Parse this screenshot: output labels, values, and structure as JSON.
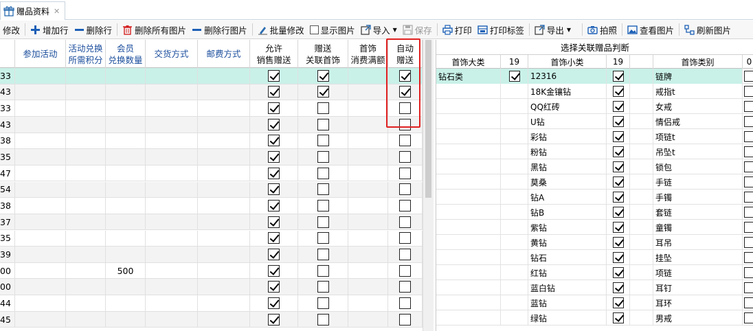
{
  "tab": {
    "label": "赠品资料",
    "close": "✕"
  },
  "toolbar": {
    "items": [
      {
        "key": "edit",
        "label": "修改"
      },
      {
        "key": "add_row",
        "label": "增加行"
      },
      {
        "key": "delete_row",
        "label": "删除行"
      },
      {
        "key": "delete_all_images",
        "label": "删除所有图片"
      },
      {
        "key": "delete_row_image",
        "label": "删除行图片"
      },
      {
        "key": "batch_edit",
        "label": "批量修改"
      },
      {
        "key": "show_images",
        "label": "显示图片"
      },
      {
        "key": "import",
        "label": "导入"
      },
      {
        "key": "save",
        "label": "保存"
      },
      {
        "key": "print",
        "label": "打印"
      },
      {
        "key": "print_label",
        "label": "打印标签"
      },
      {
        "key": "export",
        "label": "导出"
      },
      {
        "key": "photo",
        "label": "拍照"
      },
      {
        "key": "view_images",
        "label": "查看图片"
      },
      {
        "key": "refresh_images",
        "label": "刷新图片"
      }
    ]
  },
  "left_grid": {
    "headers": {
      "activity": "参加活动",
      "points_l1": "活动兑换",
      "points_l2": "所需积分",
      "member_l1": "会员",
      "member_l2": "兑换数量",
      "delivery": "交货方式",
      "postage": "邮费方式",
      "allow_l1": "允许",
      "allow_l2": "销售赠送",
      "gift_l1": "赠送",
      "gift_l2": "关联首饰",
      "jewelry_l1": "首饰",
      "jewelry_l2": "消费满额",
      "auto_l1": "自动",
      "auto_l2": "赠送"
    },
    "rows": [
      {
        "id": "33",
        "member_qty": "",
        "allow": true,
        "gift": true,
        "auto": true
      },
      {
        "id": "43",
        "member_qty": "",
        "allow": true,
        "gift": true,
        "auto": true
      },
      {
        "id": "33",
        "member_qty": "",
        "allow": true,
        "gift": false,
        "auto": false
      },
      {
        "id": "43",
        "member_qty": "",
        "allow": true,
        "gift": false,
        "auto": false
      },
      {
        "id": "38",
        "member_qty": "",
        "allow": true,
        "gift": false,
        "auto": false
      },
      {
        "id": "35",
        "member_qty": "",
        "allow": true,
        "gift": false,
        "auto": false
      },
      {
        "id": "47",
        "member_qty": "",
        "allow": true,
        "gift": false,
        "auto": false
      },
      {
        "id": "54",
        "member_qty": "",
        "allow": true,
        "gift": false,
        "auto": false
      },
      {
        "id": "38",
        "member_qty": "",
        "allow": true,
        "gift": false,
        "auto": false
      },
      {
        "id": "37",
        "member_qty": "",
        "allow": true,
        "gift": false,
        "auto": false
      },
      {
        "id": "35",
        "member_qty": "",
        "allow": true,
        "gift": false,
        "auto": false
      },
      {
        "id": "39",
        "member_qty": "",
        "allow": true,
        "gift": false,
        "auto": false
      },
      {
        "id": "00",
        "member_qty": "500",
        "allow": true,
        "gift": false,
        "auto": false
      },
      {
        "id": "00",
        "member_qty": "",
        "allow": true,
        "gift": false,
        "auto": false
      },
      {
        "id": "44",
        "member_qty": "",
        "allow": true,
        "gift": false,
        "auto": false
      },
      {
        "id": "45",
        "member_qty": "",
        "allow": true,
        "gift": false,
        "auto": false
      }
    ]
  },
  "right_panel": {
    "title": "选择关联赠品判断",
    "headers": {
      "big_cat": "首饰大类",
      "big_count": "19",
      "small_cat": "首饰小类",
      "small_count": "19",
      "category": "首饰类别",
      "cat_count": "0"
    },
    "big_categories": [
      {
        "label": "钻石类",
        "checked": true
      }
    ],
    "small_categories": [
      {
        "label": "12316",
        "checked": true
      },
      {
        "label": "18K金镶钻",
        "checked": true
      },
      {
        "label": "QQ红砖",
        "checked": true
      },
      {
        "label": "U钻",
        "checked": true
      },
      {
        "label": "彩钻",
        "checked": true
      },
      {
        "label": "粉钻",
        "checked": true
      },
      {
        "label": "黑钻",
        "checked": true
      },
      {
        "label": "莫桑",
        "checked": true
      },
      {
        "label": "钻A",
        "checked": true
      },
      {
        "label": "钻B",
        "checked": true
      },
      {
        "label": "紫钻",
        "checked": true
      },
      {
        "label": "黄钻",
        "checked": true
      },
      {
        "label": "钻石",
        "checked": true
      },
      {
        "label": "红钻",
        "checked": true
      },
      {
        "label": "蓝白钻",
        "checked": true
      },
      {
        "label": "蓝钻",
        "checked": true
      },
      {
        "label": "绿钻",
        "checked": true
      }
    ],
    "categories": [
      {
        "label": "链牌"
      },
      {
        "label": "戒指t"
      },
      {
        "label": "女戒"
      },
      {
        "label": "情侣戒"
      },
      {
        "label": "项链t"
      },
      {
        "label": "吊坠t"
      },
      {
        "label": "锁包"
      },
      {
        "label": "手链"
      },
      {
        "label": "手镯"
      },
      {
        "label": "套链"
      },
      {
        "label": "童镯"
      },
      {
        "label": "耳吊"
      },
      {
        "label": "挂坠"
      },
      {
        "label": "项链"
      },
      {
        "label": "耳钉"
      },
      {
        "label": "耳环"
      },
      {
        "label": "男戒"
      }
    ]
  },
  "colors": {
    "selected_row": "#c9f1e8",
    "highlight": "#e02020",
    "header_text": "#1a4d9c"
  }
}
